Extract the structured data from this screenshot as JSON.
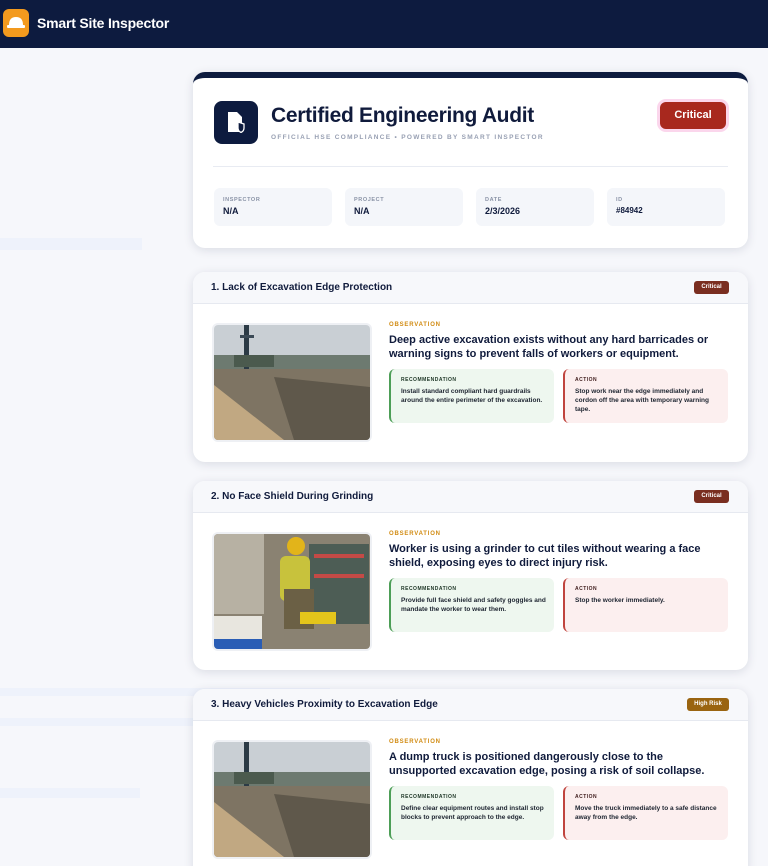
{
  "app": {
    "name": "Smart Site Inspector",
    "logo_icon": "hard-hat-icon"
  },
  "report": {
    "title": "Certified Engineering Audit",
    "subtitle": "OFFICIAL HSE COMPLIANCE • POWERED BY SMART INSPECTOR",
    "doc_icon": "shield-document-icon",
    "severity_label": "Critical",
    "meta": [
      {
        "label": "INSPECTOR",
        "value": "N/A"
      },
      {
        "label": "PROJECT",
        "value": "N/A"
      },
      {
        "label": "DATE",
        "value": "2/3/2026"
      },
      {
        "label": "ID",
        "value": "#84942"
      }
    ]
  },
  "issues": [
    {
      "title": "1. Lack of Excavation Edge Protection",
      "severity": "Critical",
      "observation_label": "OBSERVATION",
      "observation": "Deep active excavation exists without any hard barricades or warning signs to prevent falls of workers or equipment.",
      "recommendation_label": "RECOMMENDATION",
      "recommendation": "Install standard compliant hard guardrails around the entire perimeter of the excavation.",
      "action_label": "ACTION",
      "action": "Stop work near the edge immediately and cordon off the area with temporary warning tape."
    },
    {
      "title": "2. No Face Shield During Grinding",
      "severity": "Critical",
      "observation_label": "OBSERVATION",
      "observation": "Worker is using a grinder to cut tiles without wearing a face shield, exposing eyes to direct injury risk.",
      "recommendation_label": "RECOMMENDATION",
      "recommendation": "Provide full face shield and safety goggles and mandate the worker to wear them.",
      "action_label": "ACTION",
      "action": "Stop the worker immediately."
    },
    {
      "title": "3. Heavy Vehicles Proximity to Excavation Edge",
      "severity": "High Risk",
      "observation_label": "OBSERVATION",
      "observation": "A dump truck is positioned dangerously close to the unsupported excavation edge, posing a risk of soil collapse.",
      "recommendation_label": "RECOMMENDATION",
      "recommendation": "Define clear equipment routes and install stop blocks to prevent approach to the edge.",
      "action_label": "ACTION",
      "action": "Move the truck immediately to a safe distance away from the edge."
    }
  ],
  "colors": {
    "navy": "#0d1b3f",
    "critical": "#a8281e",
    "high_risk": "#9a6410",
    "observation": "#d18b12"
  }
}
